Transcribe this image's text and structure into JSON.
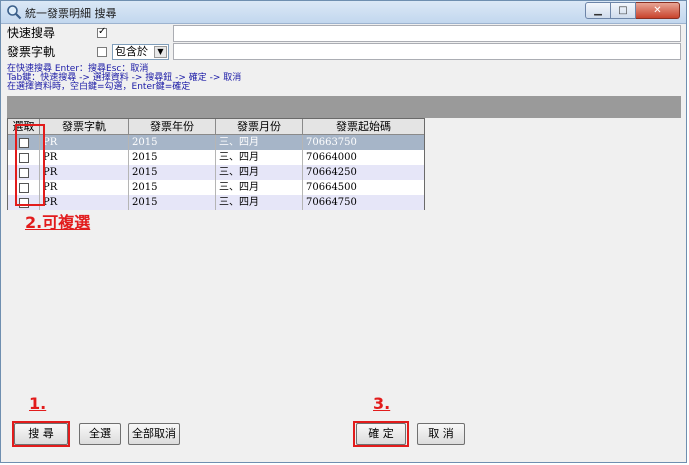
{
  "window": {
    "title": "統一發票明細 搜尋",
    "controls": {
      "minimize": "▁",
      "maximize": "□",
      "close": "✕"
    }
  },
  "filters": {
    "quick_search_label": "快速搜尋",
    "quick_search_checked": true,
    "quick_search_mark": "✓",
    "invoice_track_label": "發票字軌",
    "invoice_track_checked": false,
    "match_mode": "包含於",
    "invoice_track_value": ""
  },
  "hints": [
    "在快速搜尋 Enter：搜尋Esc：取消",
    "Tab鍵：快速搜尋 -> 選擇資料 -> 搜尋鈕 -> 確定 -> 取消",
    "在選擇資料時，空白鍵=勾選，Enter鍵=確定"
  ],
  "table": {
    "columns": [
      "選取",
      "發票字軌",
      "發票年份",
      "發票月份",
      "發票起始碼"
    ],
    "rows": [
      {
        "selected": false,
        "track": "PR",
        "year": "2015",
        "month": "三、四月",
        "start": "70663750"
      },
      {
        "selected": false,
        "track": "PR",
        "year": "2015",
        "month": "三、四月",
        "start": "70664000"
      },
      {
        "selected": false,
        "track": "PR",
        "year": "2015",
        "month": "三、四月",
        "start": "70664250"
      },
      {
        "selected": false,
        "track": "PR",
        "year": "2015",
        "month": "三、四月",
        "start": "70664500"
      },
      {
        "selected": false,
        "track": "PR",
        "year": "2015",
        "month": "三、四月",
        "start": "70664750"
      }
    ]
  },
  "annotations": {
    "multi_select": "2.可複選",
    "step1": "1.",
    "step3": "3."
  },
  "buttons": {
    "search": "搜 尋",
    "select_all": "全選",
    "deselect_all": "全部取消",
    "ok": "確 定",
    "cancel": "取 消"
  },
  "colors": {
    "annotation_red": "#e21c1c",
    "selected_row": "#a6b5c8",
    "alt_row": "#e6e6f8",
    "hint_text": "#1a1aa6"
  }
}
